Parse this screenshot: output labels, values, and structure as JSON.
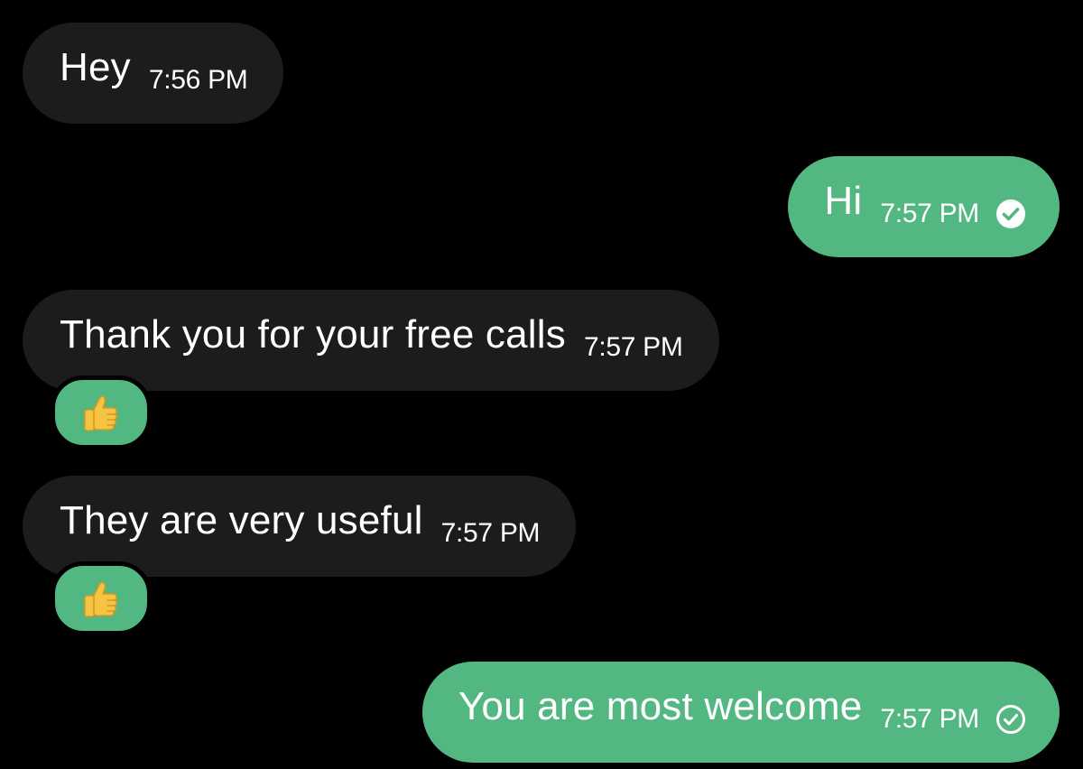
{
  "colors": {
    "background": "#000000",
    "incoming_bubble": "#1c1c1e",
    "outgoing_bubble": "#53b781",
    "text": "#ffffff"
  },
  "messages": [
    {
      "direction": "incoming",
      "text": "Hey",
      "time": "7:56 PM"
    },
    {
      "direction": "outgoing",
      "text": "Hi",
      "time": "7:57 PM",
      "status": "read",
      "status_icon": "filled-check-circle-icon"
    },
    {
      "direction": "incoming",
      "text": "Thank you for your free calls",
      "time": "7:57 PM",
      "reaction": "thumbs-up-icon"
    },
    {
      "direction": "incoming",
      "text": "They are very useful",
      "time": "7:57 PM",
      "reaction": "thumbs-up-icon"
    },
    {
      "direction": "outgoing",
      "text": "You are most welcome",
      "time": "7:57 PM",
      "status": "sent",
      "status_icon": "outline-check-circle-icon"
    }
  ]
}
